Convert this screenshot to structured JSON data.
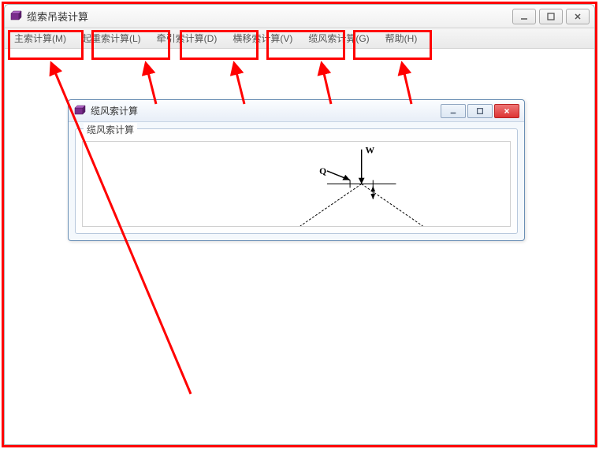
{
  "main_window": {
    "title": "缆索吊装计算"
  },
  "menu": {
    "items": [
      {
        "label": "主索计算(M)"
      },
      {
        "label": "起重索计算(L)"
      },
      {
        "label": "牵引索计算(D)"
      },
      {
        "label": "横移索计算(V)"
      },
      {
        "label": "缆风索计算(G)"
      },
      {
        "label": "帮助(H)"
      }
    ]
  },
  "inner_window": {
    "title": "缆风索计算",
    "group_label": "缆风索计算",
    "diagram": {
      "label_w": "W",
      "label_q": "Q"
    }
  }
}
